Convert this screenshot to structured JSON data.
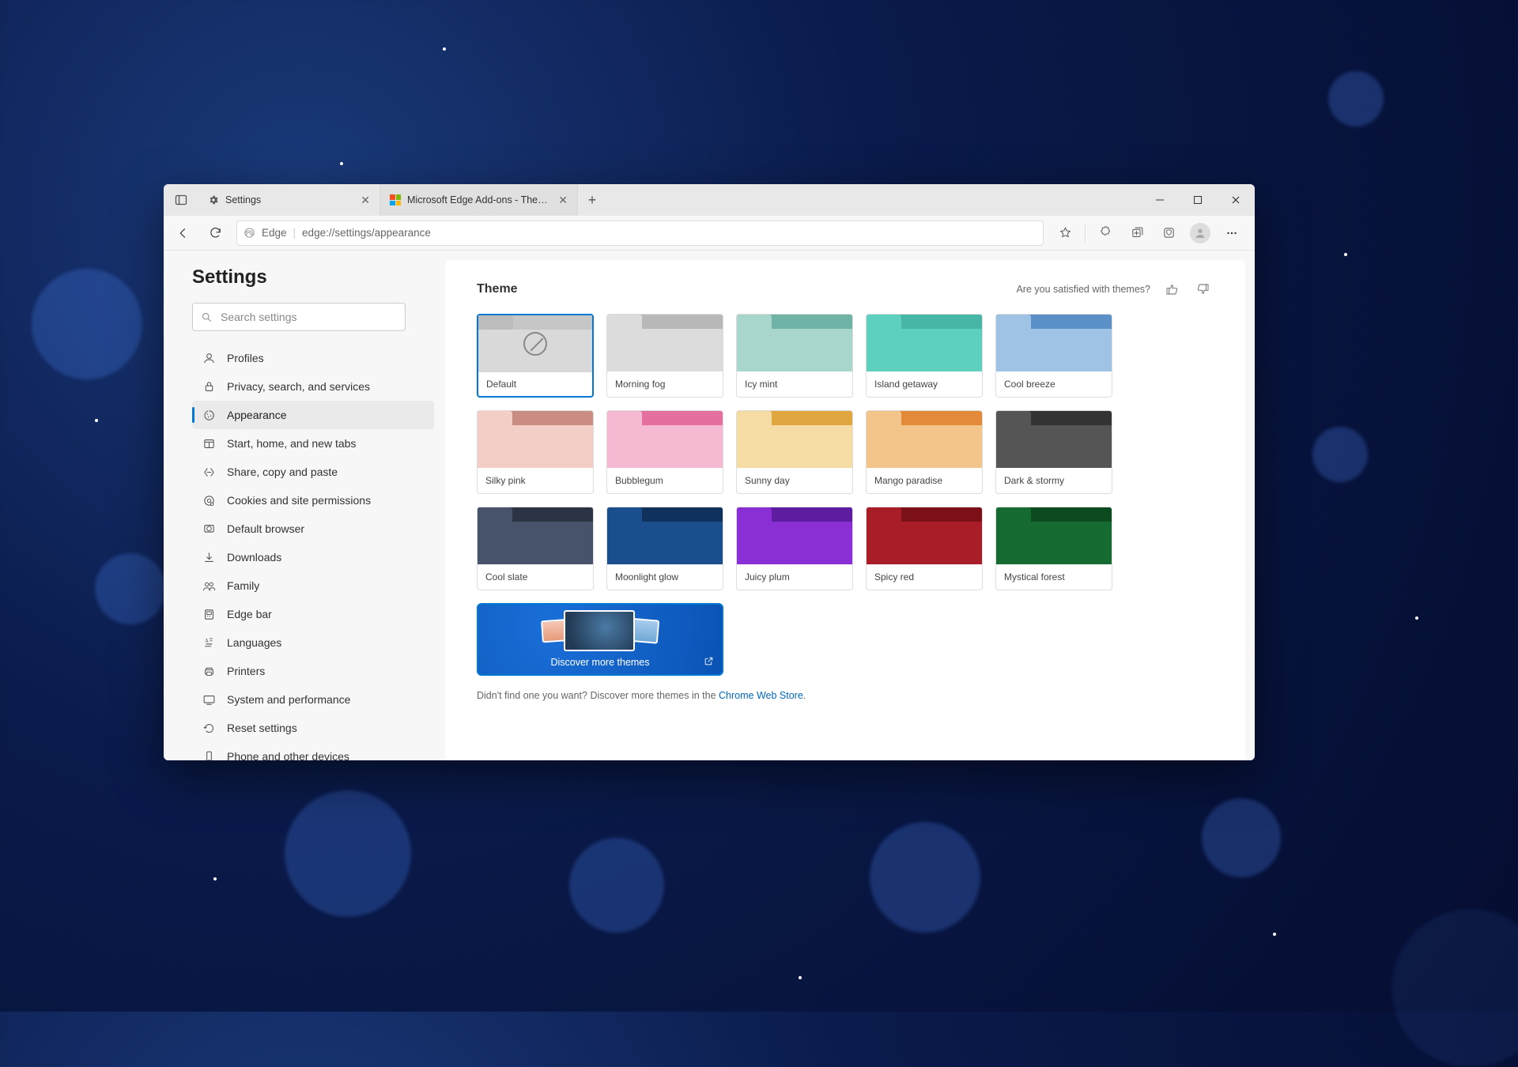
{
  "tabs": [
    {
      "label": "Settings"
    },
    {
      "label": "Microsoft Edge Add-ons - Theme"
    }
  ],
  "address": {
    "scheme_label": "Edge",
    "url": "edge://settings/appearance"
  },
  "sidebar": {
    "title": "Settings",
    "search_placeholder": "Search settings",
    "items": [
      {
        "label": "Profiles"
      },
      {
        "label": "Privacy, search, and services"
      },
      {
        "label": "Appearance"
      },
      {
        "label": "Start, home, and new tabs"
      },
      {
        "label": "Share, copy and paste"
      },
      {
        "label": "Cookies and site permissions"
      },
      {
        "label": "Default browser"
      },
      {
        "label": "Downloads"
      },
      {
        "label": "Family"
      },
      {
        "label": "Edge bar"
      },
      {
        "label": "Languages"
      },
      {
        "label": "Printers"
      },
      {
        "label": "System and performance"
      },
      {
        "label": "Reset settings"
      },
      {
        "label": "Phone and other devices"
      }
    ],
    "active_index": 2
  },
  "main": {
    "section_title": "Theme",
    "feedback_prompt": "Are you satisfied with themes?",
    "themes": [
      {
        "label": "Default",
        "top": "#c6c6c6",
        "body": "#d9d9d9",
        "default": true
      },
      {
        "label": "Morning fog",
        "top": "#b8b8b8",
        "body": "#dcdcdc"
      },
      {
        "label": "Icy mint",
        "top": "#6fb3a6",
        "body": "#a8d5cc"
      },
      {
        "label": "Island getaway",
        "top": "#47b6a7",
        "body": "#5dd0c0"
      },
      {
        "label": "Cool breeze",
        "top": "#5a8fc7",
        "body": "#9fc3e5"
      },
      {
        "label": "Silky pink",
        "top": "#c98d84",
        "body": "#f3cec6"
      },
      {
        "label": "Bubblegum",
        "top": "#e570a0",
        "body": "#f6b9d2"
      },
      {
        "label": "Sunny day",
        "top": "#e0a63f",
        "body": "#f5dca4"
      },
      {
        "label": "Mango paradise",
        "top": "#e38a3a",
        "body": "#f4c58a"
      },
      {
        "label": "Dark & stormy",
        "top": "#333333",
        "body": "#555555"
      },
      {
        "label": "Cool slate",
        "top": "#2a3442",
        "body": "#46536a"
      },
      {
        "label": "Moonlight glow",
        "top": "#10315c",
        "body": "#1b4e8c"
      },
      {
        "label": "Juicy plum",
        "top": "#5e1da1",
        "body": "#8a2fd6"
      },
      {
        "label": "Spicy red",
        "top": "#7b1018",
        "body": "#a81d27"
      },
      {
        "label": "Mystical forest",
        "top": "#0c4a20",
        "body": "#156b31"
      }
    ],
    "selected_index": 0,
    "discover_label": "Discover more themes",
    "note_prefix": "Didn't find one you want? Discover more themes in the ",
    "note_link": "Chrome Web Store",
    "note_suffix": "."
  }
}
